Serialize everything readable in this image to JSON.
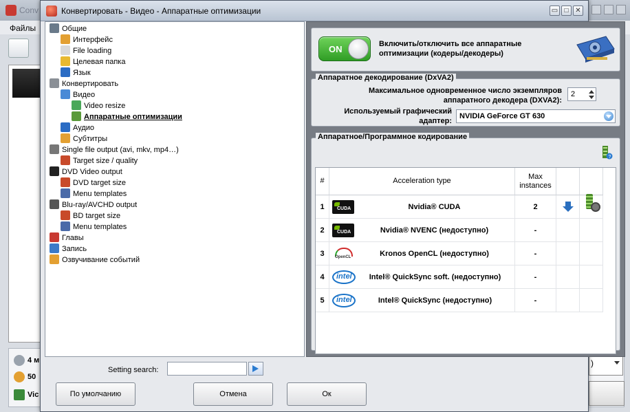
{
  "background_app": {
    "title": "Conv",
    "menu_files": "Файлы",
    "bottom_rows": [
      "4 м",
      "50",
      "Vic"
    ],
    "right_combo_value": ")"
  },
  "dialog": {
    "title": "Конвертировать - Видео - Аппаратные оптимизации",
    "window_buttons": [
      "▭",
      "□",
      "✕"
    ]
  },
  "tree": {
    "items": [
      {
        "label": "Общие",
        "icon": "tools-icon",
        "color": "#6a7a8a"
      },
      {
        "label": "Интерфейс",
        "icon": "palette-icon",
        "color": "#e3a032"
      },
      {
        "label": "File loading",
        "icon": "file-icon",
        "color": "#d9d9d9"
      },
      {
        "label": "Целевая папка",
        "icon": "folder-icon",
        "color": "#e8b930"
      },
      {
        "label": "Язык",
        "icon": "globe-icon",
        "color": "#2b6cc4"
      },
      {
        "label": "Конвертировать",
        "icon": "gear-icon",
        "color": "#8a8f96"
      },
      {
        "label": "Видео",
        "icon": "video-icon",
        "color": "#4a8ad6"
      },
      {
        "label": "Video resize",
        "icon": "resize-icon",
        "color": "#4aa85a"
      },
      {
        "label": "Аппаратные оптимизации",
        "icon": "chip-icon",
        "color": "#5a9a3a"
      },
      {
        "label": "Аудио",
        "icon": "music-note-icon",
        "color": "#2b6cc4"
      },
      {
        "label": "Субтитры",
        "icon": "subtitles-icon",
        "color": "#e3a032"
      },
      {
        "label": "Single file output (avi, mkv, mp4…)",
        "icon": "film-icon",
        "color": "#777"
      },
      {
        "label": "Target size / quality",
        "icon": "target-icon",
        "color": "#c84a2a"
      },
      {
        "label": "DVD Video output",
        "icon": "dvd-icon",
        "color": "#222"
      },
      {
        "label": "DVD target size",
        "icon": "target-icon",
        "color": "#c84a2a"
      },
      {
        "label": "Menu templates",
        "icon": "menu-list-icon",
        "color": "#4a6aa8"
      },
      {
        "label": "Blu-ray/AVCHD output",
        "icon": "hd-icon",
        "color": "#555"
      },
      {
        "label": "BD target size",
        "icon": "target-icon",
        "color": "#c84a2a"
      },
      {
        "label": "Menu templates",
        "icon": "menu-list-icon",
        "color": "#4a6aa8"
      },
      {
        "label": "Главы",
        "icon": "flag-icon",
        "color": "#c83a32"
      },
      {
        "label": "Запись",
        "icon": "disc-icon",
        "color": "#3a7ac8"
      },
      {
        "label": "Озвучивание событий",
        "icon": "speaker-icon",
        "color": "#e3a032"
      }
    ]
  },
  "search": {
    "label": "Setting search:",
    "value": ""
  },
  "buttons": {
    "default": "По умолчанию",
    "cancel": "Отмена",
    "ok": "Ок"
  },
  "hw": {
    "toggle_label": "ON",
    "toggle_text": "Включить/отключить все аппаратные оптимизации (кодеры/декодеры)",
    "decode_group_title": "Аппаратное декодирование (DxVA2)",
    "max_instances_label": "Максимальное одновременное число экземпляров аппаратного декодера (DXVA2):",
    "max_instances_value": "2",
    "adapter_label": "Используемый графический адаптер:",
    "adapter_value": "NVIDIA GeForce GT 630",
    "encode_group_title": "Аппаратное/Программное кодирование"
  },
  "table": {
    "headers": [
      "#",
      "Acceleration type",
      "Max instances",
      "",
      ""
    ],
    "rows": [
      {
        "num": "1",
        "logo": "nvidia-cuda-logo",
        "type": "Nvidia® CUDA",
        "max": "2"
      },
      {
        "num": "2",
        "logo": "nvidia-cuda-logo",
        "type": "Nvidia® NVENC (недоступно)",
        "max": "-"
      },
      {
        "num": "3",
        "logo": "opencl-logo",
        "type": "Kronos OpenCL (недоступно)",
        "max": "-"
      },
      {
        "num": "4",
        "logo": "intel-logo",
        "type": "Intel® QuickSync soft. (недоступно)",
        "max": "-"
      },
      {
        "num": "5",
        "logo": "intel-logo",
        "type": "Intel® QuickSync (недоступно)",
        "max": "-"
      }
    ]
  }
}
